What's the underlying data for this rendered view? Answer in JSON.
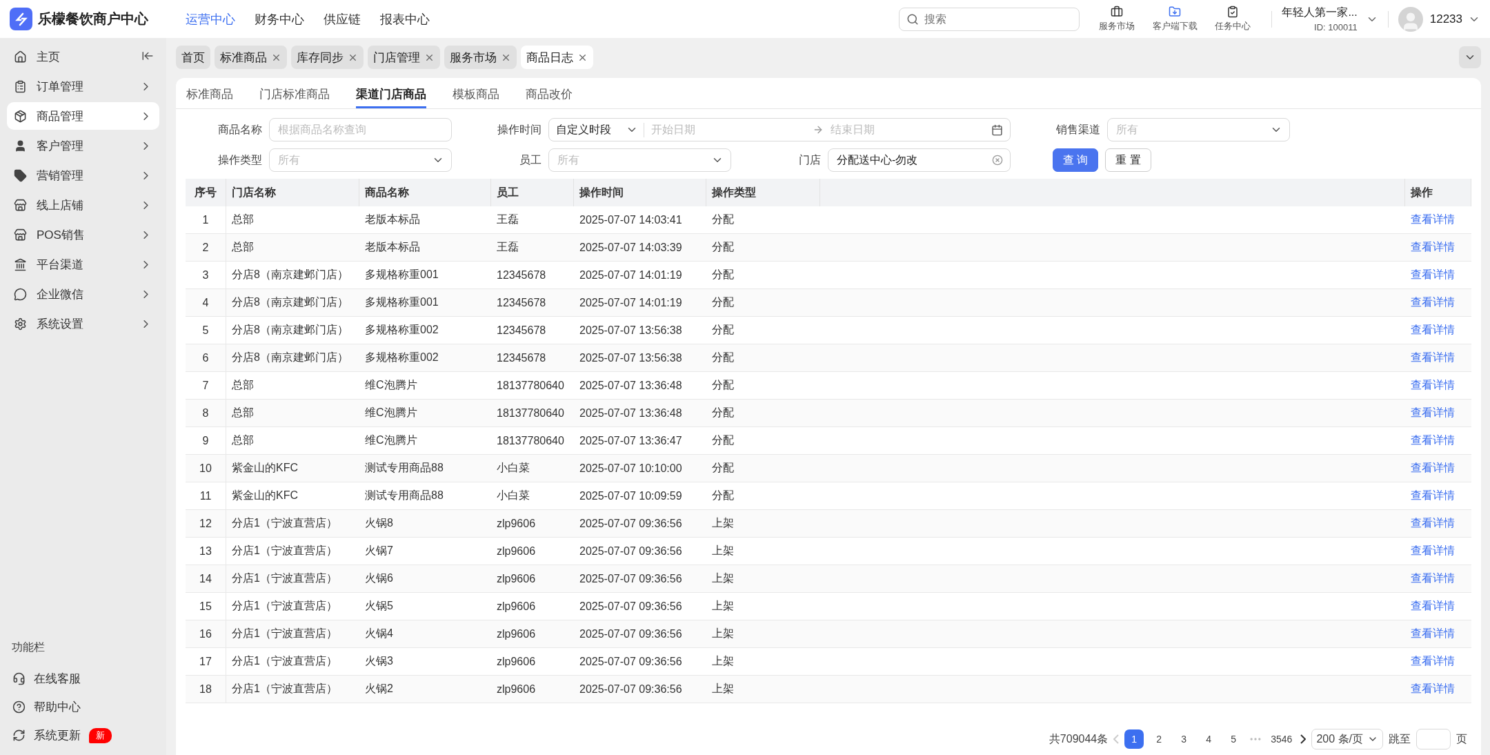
{
  "app": {
    "title": "乐檬餐饮商户中心"
  },
  "top_nav": [
    {
      "label": "运营中心",
      "selected": true
    },
    {
      "label": "财务中心",
      "selected": false
    },
    {
      "label": "供应链",
      "selected": false
    },
    {
      "label": "报表中心",
      "selected": false
    }
  ],
  "search": {
    "placeholder": "搜索"
  },
  "tools": [
    {
      "label": "服务市场"
    },
    {
      "label": "客户端下载"
    },
    {
      "label": "任务中心"
    }
  ],
  "account": {
    "name": "年轻人第一家...",
    "id": "ID: 100011"
  },
  "user": {
    "name": "12233"
  },
  "sidebar": {
    "items": [
      {
        "label": "主页",
        "kind": "link",
        "selected": false
      },
      {
        "label": "订单管理",
        "kind": "group",
        "selected": false
      },
      {
        "label": "商品管理",
        "kind": "group",
        "selected": true
      },
      {
        "label": "客户管理",
        "kind": "group",
        "selected": false
      },
      {
        "label": "营销管理",
        "kind": "group",
        "selected": false
      },
      {
        "label": "线上店铺",
        "kind": "group",
        "selected": false
      },
      {
        "label": "POS销售",
        "kind": "group",
        "selected": false
      },
      {
        "label": "平台渠道",
        "kind": "group",
        "selected": false
      },
      {
        "label": "企业微信",
        "kind": "group",
        "selected": false
      },
      {
        "label": "系统设置",
        "kind": "group",
        "selected": false
      }
    ],
    "section_title": "功能栏",
    "utilities": [
      {
        "label": "在线客服"
      },
      {
        "label": "帮助中心"
      },
      {
        "label": "系统更新",
        "badge": "新"
      }
    ]
  },
  "page_tabs": [
    {
      "label": "首页",
      "closable": false,
      "selected": false
    },
    {
      "label": "标准商品",
      "closable": true,
      "selected": false
    },
    {
      "label": "库存同步",
      "closable": true,
      "selected": false
    },
    {
      "label": "门店管理",
      "closable": true,
      "selected": false
    },
    {
      "label": "服务市场",
      "closable": true,
      "selected": false
    },
    {
      "label": "商品日志",
      "closable": true,
      "selected": true
    }
  ],
  "sub_tabs": [
    {
      "label": "标准商品",
      "selected": false
    },
    {
      "label": "门店标准商品",
      "selected": false
    },
    {
      "label": "渠道门店商品",
      "selected": true
    },
    {
      "label": "模板商品",
      "selected": false
    },
    {
      "label": "商品改价",
      "selected": false
    }
  ],
  "filters": [
    {
      "label": "商品名称",
      "kind": "text",
      "placeholder": "根据商品名称查询"
    },
    {
      "label": "操作时间",
      "kind": "daterange",
      "preset": "自定义时段",
      "start_placeholder": "开始日期",
      "end_placeholder": "结束日期"
    },
    {
      "label": "销售渠道",
      "kind": "select",
      "placeholder": "所有"
    },
    {
      "label": "操作类型",
      "kind": "select",
      "placeholder": "所有"
    },
    {
      "label": "员工",
      "kind": "select",
      "placeholder": "所有"
    },
    {
      "label": "门店",
      "kind": "clearable",
      "value": "分配送中心-勿改"
    }
  ],
  "buttons": {
    "query": "查 询",
    "reset": "重 置"
  },
  "table": {
    "columns": [
      "序号",
      "门店名称",
      "商品名称",
      "员工",
      "操作时间",
      "操作类型",
      "操作"
    ],
    "rows": [
      {
        "cells": [
          "1",
          "总部",
          "老版本标品",
          "王磊",
          "2025-07-07 14:03:41",
          "分配"
        ],
        "action": "查看详情"
      },
      {
        "cells": [
          "2",
          "总部",
          "老版本标品",
          "王磊",
          "2025-07-07 14:03:39",
          "分配"
        ],
        "action": "查看详情"
      },
      {
        "cells": [
          "3",
          "分店8（南京建邺门店）",
          "多规格称重001",
          "12345678",
          "2025-07-07 14:01:19",
          "分配"
        ],
        "action": "查看详情"
      },
      {
        "cells": [
          "4",
          "分店8（南京建邺门店）",
          "多规格称重001",
          "12345678",
          "2025-07-07 14:01:19",
          "分配"
        ],
        "action": "查看详情"
      },
      {
        "cells": [
          "5",
          "分店8（南京建邺门店）",
          "多规格称重002",
          "12345678",
          "2025-07-07 13:56:38",
          "分配"
        ],
        "action": "查看详情"
      },
      {
        "cells": [
          "6",
          "分店8（南京建邺门店）",
          "多规格称重002",
          "12345678",
          "2025-07-07 13:56:38",
          "分配"
        ],
        "action": "查看详情"
      },
      {
        "cells": [
          "7",
          "总部",
          "维C泡腾片",
          "18137780640",
          "2025-07-07 13:36:48",
          "分配"
        ],
        "action": "查看详情"
      },
      {
        "cells": [
          "8",
          "总部",
          "维C泡腾片",
          "18137780640",
          "2025-07-07 13:36:48",
          "分配"
        ],
        "action": "查看详情"
      },
      {
        "cells": [
          "9",
          "总部",
          "维C泡腾片",
          "18137780640",
          "2025-07-07 13:36:47",
          "分配"
        ],
        "action": "查看详情"
      },
      {
        "cells": [
          "10",
          "紫金山的KFC",
          "测试专用商品88",
          "小白菜",
          "2025-07-07 10:10:00",
          "分配"
        ],
        "action": "查看详情"
      },
      {
        "cells": [
          "11",
          "紫金山的KFC",
          "测试专用商品88",
          "小白菜",
          "2025-07-07 10:09:59",
          "分配"
        ],
        "action": "查看详情"
      },
      {
        "cells": [
          "12",
          "分店1（宁波直营店）",
          "火锅8",
          "zlp9606",
          "2025-07-07 09:36:56",
          "上架"
        ],
        "action": "查看详情"
      },
      {
        "cells": [
          "13",
          "分店1（宁波直营店）",
          "火锅7",
          "zlp9606",
          "2025-07-07 09:36:56",
          "上架"
        ],
        "action": "查看详情"
      },
      {
        "cells": [
          "14",
          "分店1（宁波直营店）",
          "火锅6",
          "zlp9606",
          "2025-07-07 09:36:56",
          "上架"
        ],
        "action": "查看详情"
      },
      {
        "cells": [
          "15",
          "分店1（宁波直营店）",
          "火锅5",
          "zlp9606",
          "2025-07-07 09:36:56",
          "上架"
        ],
        "action": "查看详情"
      },
      {
        "cells": [
          "16",
          "分店1（宁波直营店）",
          "火锅4",
          "zlp9606",
          "2025-07-07 09:36:56",
          "上架"
        ],
        "action": "查看详情"
      },
      {
        "cells": [
          "17",
          "分店1（宁波直营店）",
          "火锅3",
          "zlp9606",
          "2025-07-07 09:36:56",
          "上架"
        ],
        "action": "查看详情"
      },
      {
        "cells": [
          "18",
          "分店1（宁波直营店）",
          "火锅2",
          "zlp9606",
          "2025-07-07 09:36:56",
          "上架"
        ],
        "action": "查看详情"
      }
    ]
  },
  "pagination": {
    "total": "共709044条",
    "prev_disabled": true,
    "pages": [
      {
        "label": "1",
        "selected": true
      },
      {
        "label": "2",
        "selected": false
      },
      {
        "label": "3",
        "selected": false
      },
      {
        "label": "4",
        "selected": false
      },
      {
        "label": "5",
        "selected": false
      },
      {
        "label": "3546",
        "selected": false
      }
    ],
    "page_size": "200 条/页",
    "jump_label": "跳至",
    "jump_suffix": "页"
  }
}
